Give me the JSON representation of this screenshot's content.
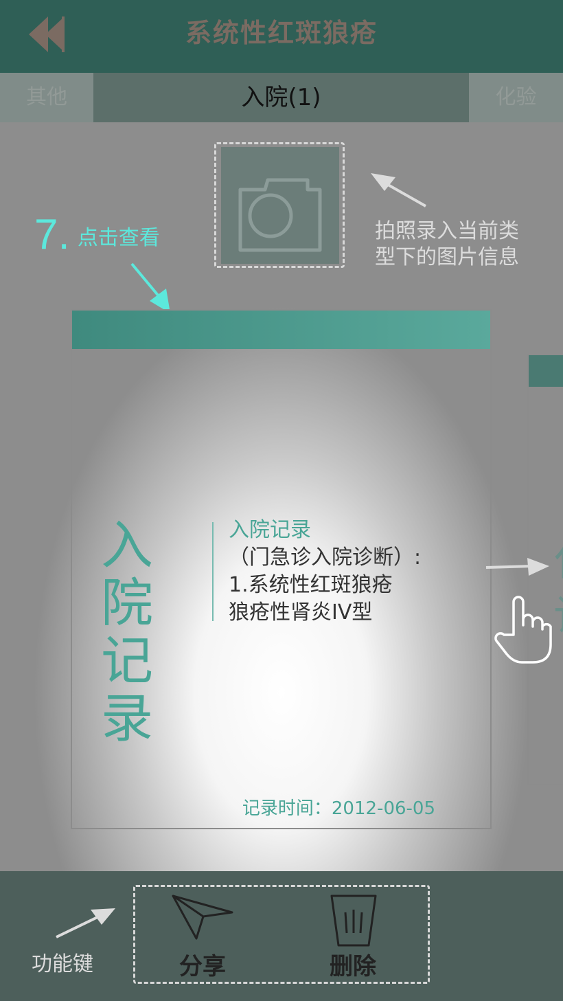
{
  "header": {
    "title": "系统性红斑狼疮"
  },
  "tabs": {
    "left": "其他",
    "active": "入院(1)",
    "right": "化验"
  },
  "camera_hint": {
    "line1": "拍照录入当前类",
    "line2": "型下的图片信息"
  },
  "step": {
    "number": "7.",
    "text": "点击查看"
  },
  "card": {
    "big_title_1": "入院",
    "big_title_2": "记录",
    "subtitle": "入院记录",
    "line1": "（门急诊入院诊断）:",
    "line2": "1.系统性红斑狼疮",
    "line3": "狼疮性肾炎IV型",
    "time": "记录时间：2012-06-05"
  },
  "next_card": {
    "t1": "化",
    "t2": "记"
  },
  "footer": {
    "func_label": "功能键",
    "share": "分享",
    "delete": "删除"
  },
  "colors": {
    "header": "#2f5f56",
    "accent": "#49a596",
    "step": "#5ce8dc"
  }
}
